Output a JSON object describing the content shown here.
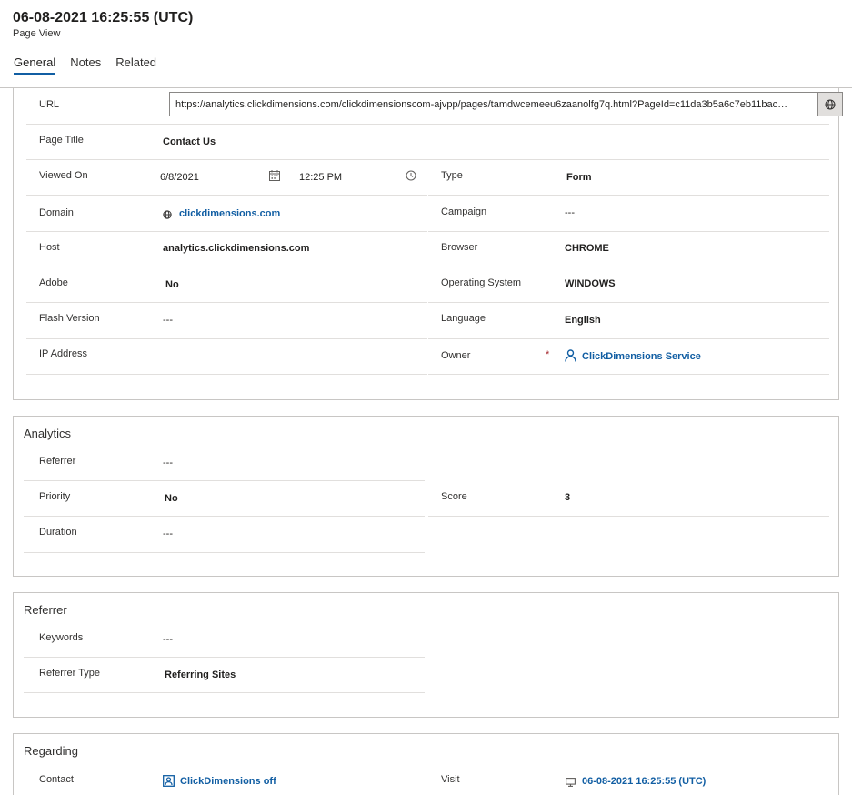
{
  "header": {
    "title": "06-08-2021 16:25:55 (UTC)",
    "subtitle": "Page View",
    "tabs": [
      "General",
      "Notes",
      "Related"
    ]
  },
  "general": {
    "url_label": "URL",
    "url_value": "https://analytics.clickdimensions.com/clickdimensionscom-ajvpp/pages/tamdwcemeeu6zaanolfg7q.html?PageId=c11da3b5a6c7eb11bac…",
    "page_title_label": "Page Title",
    "page_title_value": "Contact Us",
    "viewed_on_label": "Viewed On",
    "viewed_on_date": "6/8/2021",
    "viewed_on_time": "12:25 PM",
    "type_label": "Type",
    "type_value": "Form",
    "domain_label": "Domain",
    "domain_value": "clickdimensions.com",
    "campaign_label": "Campaign",
    "campaign_value": "---",
    "host_label": "Host",
    "host_value": "analytics.clickdimensions.com",
    "browser_label": "Browser",
    "browser_value": "CHROME",
    "adobe_label": "Adobe",
    "adobe_value": "No",
    "os_label": "Operating System",
    "os_value": "WINDOWS",
    "flash_label": "Flash Version",
    "flash_value": "---",
    "language_label": "Language",
    "language_value": "English",
    "ip_label": "IP Address",
    "owner_label": "Owner",
    "owner_required": "*",
    "owner_value": "ClickDimensions Service"
  },
  "analytics": {
    "title": "Analytics",
    "referrer_label": "Referrer",
    "referrer_value": "---",
    "priority_label": "Priority",
    "priority_value": "No",
    "score_label": "Score",
    "score_value": "3",
    "duration_label": "Duration",
    "duration_value": "---"
  },
  "referrer": {
    "title": "Referrer",
    "keywords_label": "Keywords",
    "keywords_value": "---",
    "type_label": "Referrer Type",
    "type_value": "Referring Sites"
  },
  "regarding": {
    "title": "Regarding",
    "contact_label": "Contact",
    "contact_value": "ClickDimensions off",
    "visit_label": "Visit",
    "visit_value": "06-08-2021 16:25:55 (UTC)"
  },
  "colors": {
    "accent": "#115ea3",
    "required": "#a4262c",
    "border": "#c8c6c4"
  },
  "icons": [
    "calendar-icon",
    "clock-icon",
    "globe-icon",
    "user-icon",
    "contact-icon",
    "computer-icon"
  ]
}
